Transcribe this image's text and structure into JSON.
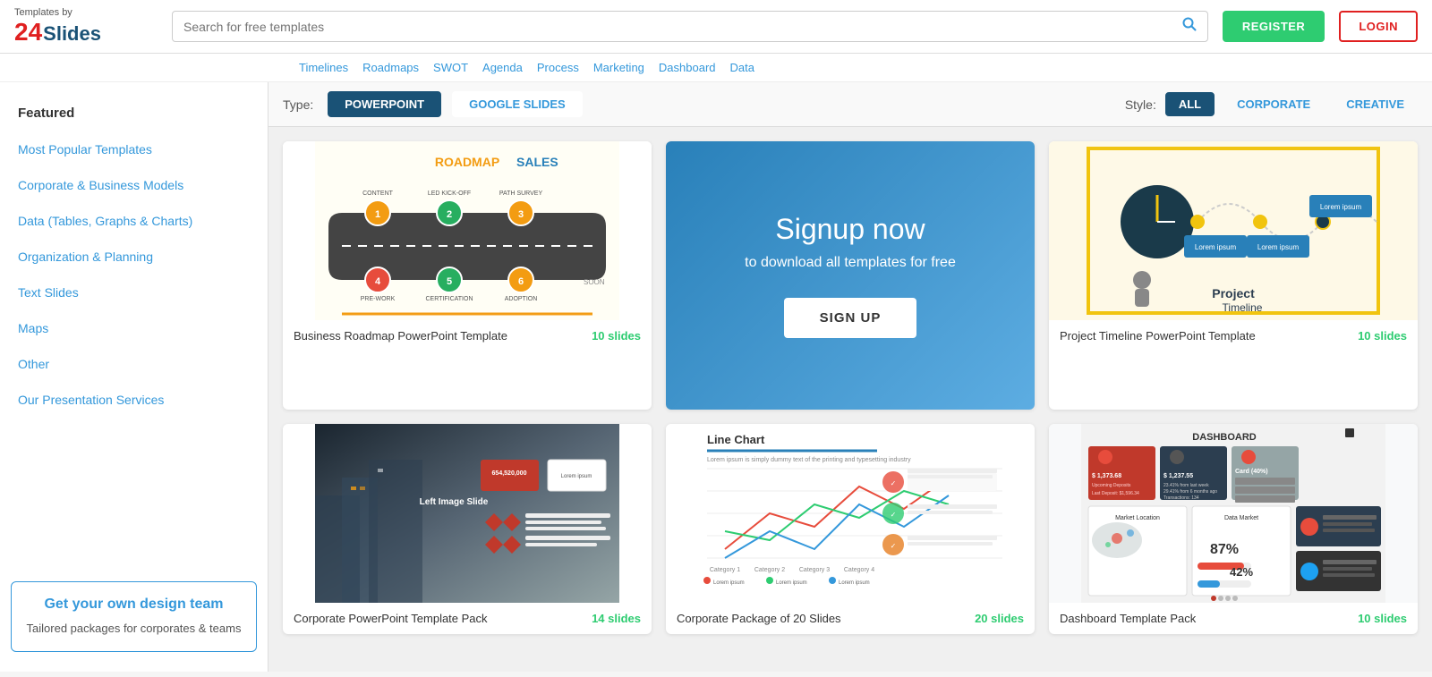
{
  "app": {
    "logo_by": "Templates by",
    "logo_24": "24",
    "logo_slides": "Slides"
  },
  "topbar": {
    "search_placeholder": "Search for free templates",
    "btn_register": "REGISTER",
    "btn_login": "LOGIN"
  },
  "tagbar": {
    "tags": [
      "Timelines",
      "Roadmaps",
      "SWOT",
      "Agenda",
      "Process",
      "Marketing",
      "Dashboard",
      "Data"
    ]
  },
  "filter": {
    "type_label": "Type:",
    "types": [
      {
        "label": "POWERPOINT",
        "active": true
      },
      {
        "label": "GOOGLE SLIDES",
        "active": false
      }
    ],
    "style_label": "Style:",
    "styles": [
      {
        "label": "ALL",
        "active": true
      },
      {
        "label": "CORPORATE",
        "active": false
      },
      {
        "label": "CREATIVE",
        "active": false
      }
    ]
  },
  "sidebar": {
    "items": [
      {
        "label": "Featured",
        "type": "plain"
      },
      {
        "label": "Most Popular Templates",
        "type": "link"
      },
      {
        "label": "Corporate & Business Models",
        "type": "link"
      },
      {
        "label": "Data (Tables, Graphs & Charts)",
        "type": "link"
      },
      {
        "label": "Organization & Planning",
        "type": "link"
      },
      {
        "label": "Text Slides",
        "type": "link"
      },
      {
        "label": "Maps",
        "type": "link"
      },
      {
        "label": "Other",
        "type": "link"
      },
      {
        "label": "Our Presentation Services",
        "type": "link"
      }
    ],
    "cta": {
      "title": "Get your own design team",
      "desc": "Tailored packages for corporates & teams"
    }
  },
  "grid": {
    "cards": [
      {
        "id": "roadmap",
        "type": "template",
        "title": "Business Roadmap PowerPoint Template",
        "slides": "10 slides",
        "thumb_type": "roadmap"
      },
      {
        "id": "signup",
        "type": "signup",
        "headline": "Signup now",
        "subline": "to download all templates for free",
        "btn": "SIGN UP"
      },
      {
        "id": "timeline",
        "type": "template",
        "title": "Project Timeline PowerPoint Template",
        "slides": "10 slides",
        "thumb_type": "timeline"
      },
      {
        "id": "corporate",
        "type": "template",
        "title": "Corporate PowerPoint Template Pack",
        "slides": "14 slides",
        "thumb_type": "corporate"
      },
      {
        "id": "linechart",
        "type": "template",
        "title": "Corporate Package of 20 Slides",
        "slides": "20 slides",
        "thumb_type": "linechart"
      },
      {
        "id": "dashboard",
        "type": "template",
        "title": "Dashboard Template Pack",
        "slides": "10 slides",
        "thumb_type": "dashboard"
      }
    ]
  }
}
